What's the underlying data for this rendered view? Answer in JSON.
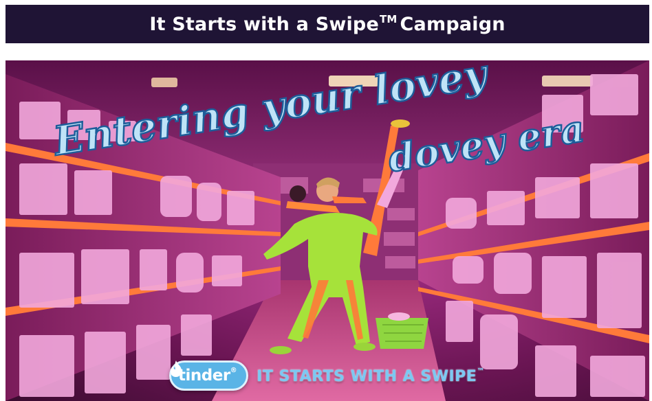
{
  "header": {
    "title_main": "It Starts with a Swipe",
    "title_tm": "TM",
    "title_tail": "Campaign"
  },
  "banner": {
    "headline_line1": "Entering your lovey",
    "headline_line2": "dovey era",
    "brand_name": "tinder",
    "brand_mark": "®",
    "tagline": "IT STARTS WITH A SWIPE",
    "tagline_tm": "™",
    "icons": [
      "tinder-flame-icon"
    ]
  },
  "colors": {
    "header_bg": "#1f1435",
    "headline_fill": "#bfe3f7",
    "headline_outline": "#1d5d9a",
    "brand_blue": "#5ab4e6",
    "shelf_pink": "#e07ac6",
    "aisle_floor": "#c0447f"
  }
}
